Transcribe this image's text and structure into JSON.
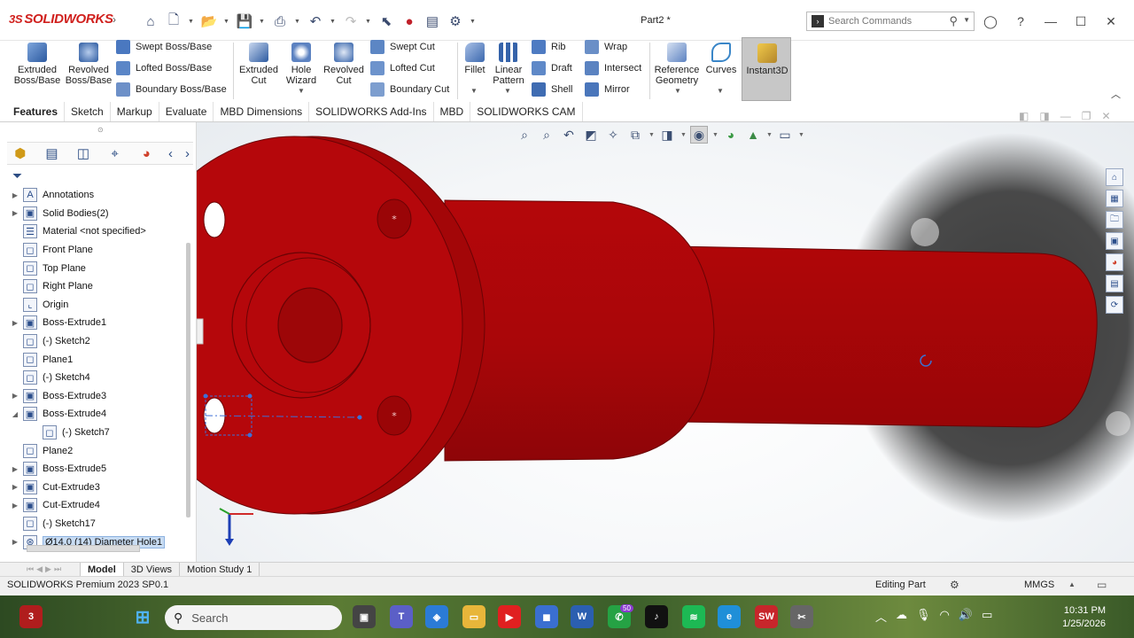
{
  "app": {
    "logo_text": "SOLIDWORKS",
    "document_title": "Part2 *"
  },
  "search": {
    "placeholder": "Search Commands"
  },
  "quick_access": [
    "home-icon",
    "new-doc-icon",
    "open-icon",
    "save-icon",
    "print-icon",
    "undo-icon",
    "redo-icon",
    "select-icon",
    "rebuild-icon",
    "file-properties-icon",
    "options-icon"
  ],
  "ribbon": {
    "extruded_boss": "Extruded\nBoss/Base",
    "revolved_boss": "Revolved\nBoss/Base",
    "swept_boss": "Swept Boss/Base",
    "lofted_boss": "Lofted Boss/Base",
    "boundary_boss": "Boundary Boss/Base",
    "extruded_cut": "Extruded\nCut",
    "hole_wizard": "Hole\nWizard",
    "revolved_cut": "Revolved\nCut",
    "swept_cut": "Swept Cut",
    "lofted_cut": "Lofted Cut",
    "boundary_cut": "Boundary Cut",
    "fillet": "Fillet",
    "linear_pattern": "Linear\nPattern",
    "rib": "Rib",
    "draft": "Draft",
    "shell": "Shell",
    "wrap": "Wrap",
    "intersect": "Intersect",
    "mirror": "Mirror",
    "reference_geometry": "Reference\nGeometry",
    "curves": "Curves",
    "instant3d": "Instant3D"
  },
  "tabs": [
    "Features",
    "Sketch",
    "Markup",
    "Evaluate",
    "MBD Dimensions",
    "SOLIDWORKS Add-Ins",
    "MBD",
    "SOLIDWORKS CAM"
  ],
  "tree": [
    {
      "label": "Annotations",
      "expandable": true
    },
    {
      "label": "Solid Bodies(2)",
      "expandable": true
    },
    {
      "label": "Material <not specified>",
      "expandable": false
    },
    {
      "label": "Front Plane",
      "expandable": false
    },
    {
      "label": "Top Plane",
      "expandable": false
    },
    {
      "label": "Right Plane",
      "expandable": false
    },
    {
      "label": "Origin",
      "expandable": false
    },
    {
      "label": "Boss-Extrude1",
      "expandable": true
    },
    {
      "label": "(-) Sketch2",
      "expandable": false
    },
    {
      "label": "Plane1",
      "expandable": false
    },
    {
      "label": "(-) Sketch4",
      "expandable": false
    },
    {
      "label": "Boss-Extrude3",
      "expandable": true
    },
    {
      "label": "Boss-Extrude4",
      "expandable": true,
      "expanded": true
    },
    {
      "label": "(-) Sketch7",
      "expandable": false,
      "indent": true
    },
    {
      "label": "Plane2",
      "expandable": false
    },
    {
      "label": "Boss-Extrude5",
      "expandable": true
    },
    {
      "label": "Cut-Extrude3",
      "expandable": true
    },
    {
      "label": "Cut-Extrude4",
      "expandable": true
    },
    {
      "label": "(-) Sketch17",
      "expandable": false
    },
    {
      "label": "Ø14.0 (14) Diameter Hole1",
      "expandable": true,
      "selected": true
    }
  ],
  "bottom_tabs": [
    "Model",
    "3D Views",
    "Motion Study 1"
  ],
  "status": {
    "product": "SOLIDWORKS Premium 2023 SP0.1",
    "mode": "Editing Part",
    "units": "MMGS"
  },
  "taskbar": {
    "search_label": "Search",
    "time": "10:31 PM",
    "date": "1/25/2026",
    "badge_count": "50",
    "notification_count": "3"
  },
  "colors": {
    "part_red": "#b5070b",
    "brand_red": "#d0201d",
    "selection": "#c8dcf3"
  }
}
